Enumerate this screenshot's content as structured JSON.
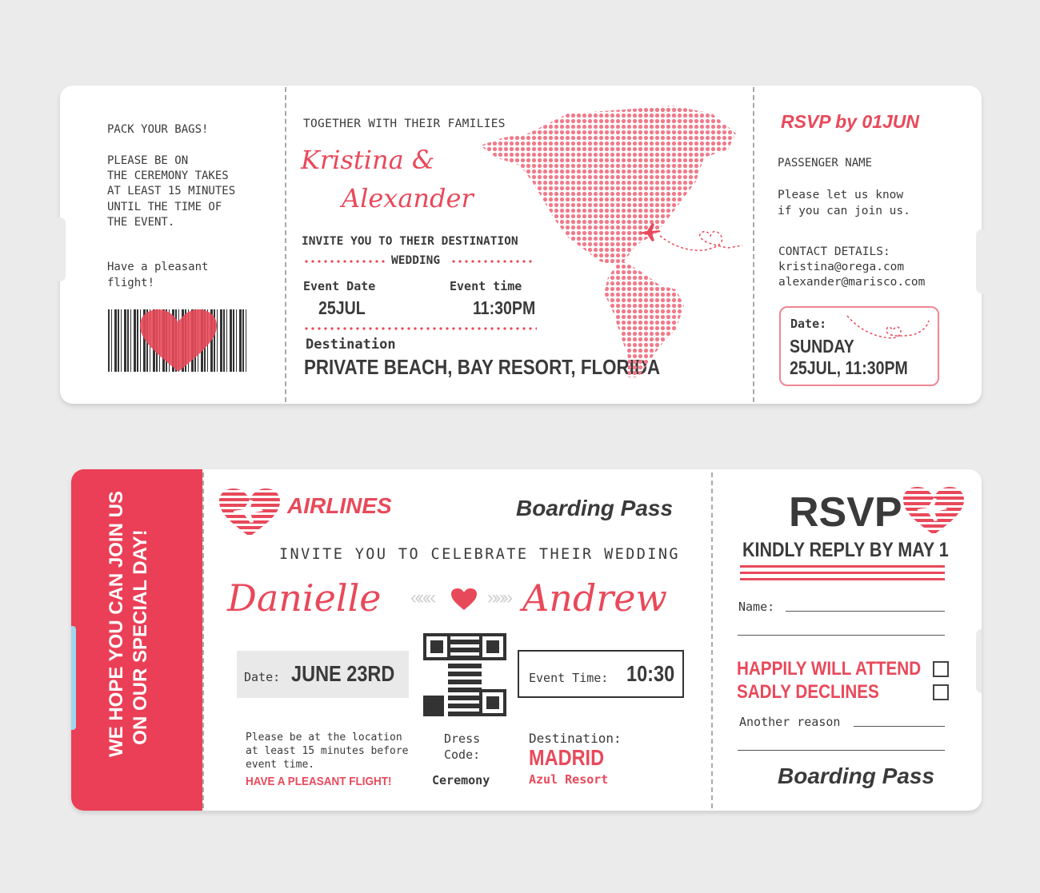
{
  "ticket1": {
    "stub_left": {
      "pack": "PACK YOUR BAGS!",
      "note": "PLEASE BE ON\nTHE CEREMONY TAKES\nAT LEAST 15 MINUTES\nUNTIL THE TIME OF\nTHE EVENT.",
      "pleasant": "Have a pleasant\nflight!"
    },
    "main": {
      "together": "TOGETHER WITH THEIR FAMILIES",
      "name1": "Kristina &",
      "name2": "Alexander",
      "invite": "INVITE YOU TO THEIR DESTINATION",
      "wedding": "WEDDING",
      "event_date_label": "Event Date",
      "event_date": "25JUL",
      "event_time_label": "Event time",
      "event_time": "11:30PM",
      "destination_label": "Destination",
      "destination": "PRIVATE BEACH, BAY RESORT, FLORIDA"
    },
    "stub_right": {
      "rsvp": "RSVP by 01JUN",
      "passenger": "PASSENGER NAME",
      "please": "Please let us know\nif you can join us.",
      "contact_label": "CONTACT DETAILS:",
      "email1": "kristina@orega.com",
      "email2": "alexander@marisco.com",
      "date_label": "Date:",
      "date_day": "SUNDAY",
      "date_value": "25JUL, 11:30PM"
    }
  },
  "ticket2": {
    "side_text1": "WE HOPE YOU CAN JOIN US",
    "side_text2": "ON OUR SPECIAL DAY!",
    "main": {
      "airlines": "AIRLINES",
      "boarding_pass": "Boarding Pass",
      "invite": "INVITE YOU TO CELEBRATE THEIR WEDDING",
      "name1": "Danielle",
      "name2": "Andrew",
      "date_label": "Date:",
      "date": "JUNE 23RD",
      "time_label": "Event Time:",
      "time": "10:30",
      "note": "Please be at the location\nat least 15 minutes before\nevent time.",
      "pleasant": "HAVE A PLEASANT FLIGHT!",
      "dress_label": "Dress\nCode:",
      "dress": "Ceremony",
      "destination_label": "Destination:",
      "destination": "MADRID",
      "resort": "Azul Resort"
    },
    "rsvp": {
      "title": "RSVP",
      "reply": "KINDLY REPLY BY MAY 1",
      "name_label": "Name:",
      "attend": "HAPPILY WILL ATTEND",
      "decline": "SADLY DECLINES",
      "reason": "Another reason",
      "boarding_pass": "Boarding Pass"
    }
  },
  "colors": {
    "accent": "#e8495a",
    "dark": "#3a3a3a",
    "background": "#ebebeb"
  }
}
